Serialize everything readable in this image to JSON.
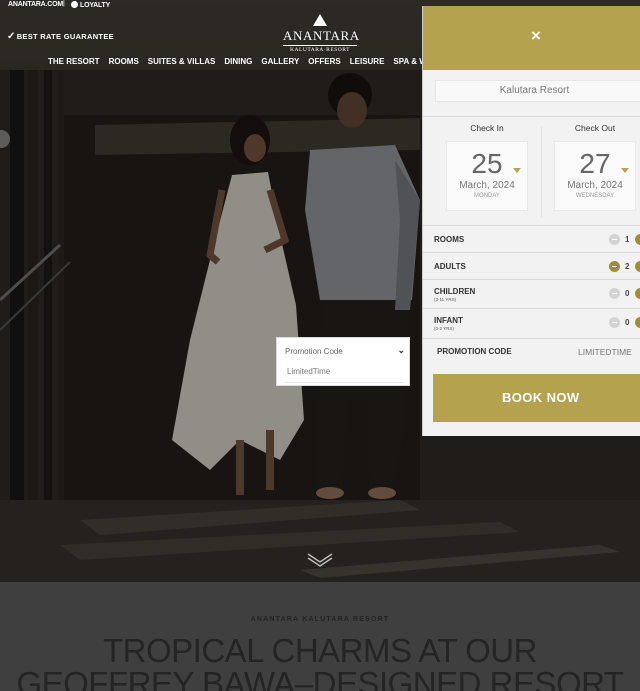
{
  "topbar": {
    "site_link": "ANANTARA.COM",
    "separator": "|",
    "loyalty_link": "LOYALTY"
  },
  "brand": {
    "best_rate": "BEST RATE GUARANTEE",
    "logo_name": "ANANTARA",
    "logo_sub": "KALUTARA·RESORT"
  },
  "nav": {
    "items": [
      "THE RESORT",
      "ROOMS",
      "SUITES & VILLAS",
      "DINING",
      "GALLERY",
      "OFFERS",
      "LEISURE",
      "SPA & WELL"
    ]
  },
  "promo_dropdown": {
    "label": "Promotion Code",
    "option": "LimitedTime"
  },
  "booking": {
    "close_symbol": "×",
    "resort": "Kalutara Resort",
    "check_in": {
      "label": "Check In",
      "day": "25",
      "month": "March, 2024",
      "weekday": "MONDAY"
    },
    "check_out": {
      "label": "Check Out",
      "day": "27",
      "month": "March, 2024",
      "weekday": "WEDNESDAY"
    },
    "rows": [
      {
        "label": "ROOMS",
        "sub": "",
        "count": "1"
      },
      {
        "label": "ADULTS",
        "sub": "",
        "count": "2"
      },
      {
        "label": "CHILDREN",
        "sub": "(3-11 YRS)",
        "count": "0"
      },
      {
        "label": "INFANT",
        "sub": "(0-2 YRS)",
        "count": "0"
      }
    ],
    "promo_label": "PROMOTION CODE",
    "promo_value": "LIMITEDTIME",
    "book_label": "BOOK NOW"
  },
  "content": {
    "eyebrow": "ANANTARA KALUTARA RESORT",
    "headline_1": "TROPICAL CHARMS AT OUR",
    "headline_2": "GEOFFREY BAWA–DESIGNED RESORT"
  },
  "colors": {
    "gold": "#b5a24e",
    "dark_gold": "#a08d35"
  }
}
